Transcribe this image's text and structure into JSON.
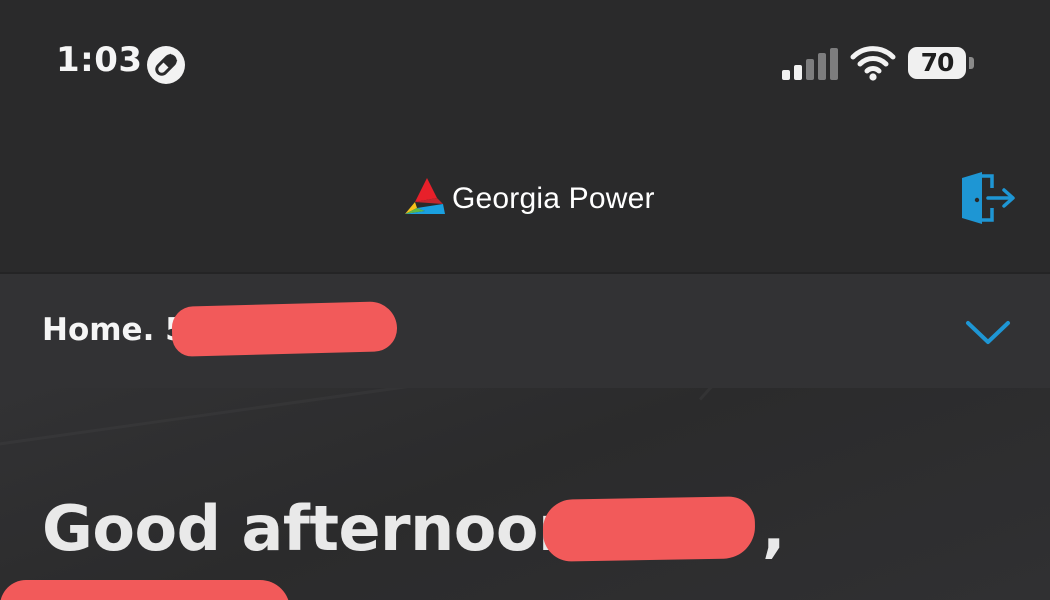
{
  "status_bar": {
    "time": "1:03",
    "battery_percent": "70",
    "focus_icon": "pill-icon",
    "signal_bars_active": 2,
    "signal_bars_total": 5
  },
  "header": {
    "brand": "Georgia Power",
    "logo_colors": {
      "red": "#e8202a",
      "yellow": "#f7c11a",
      "green": "#5fb946",
      "blue": "#1aa0e0"
    },
    "action_icon": "sign-out-icon",
    "accent": "#1e96d4"
  },
  "account": {
    "label": "Home. 5",
    "dropdown_icon": "chevron-down-icon"
  },
  "hero": {
    "greeting": "Good afternoon,",
    "trailing_comma": ","
  },
  "colors": {
    "background": "#2a2a2b",
    "account_bar": "#323234",
    "redaction": "#f25a5a"
  }
}
